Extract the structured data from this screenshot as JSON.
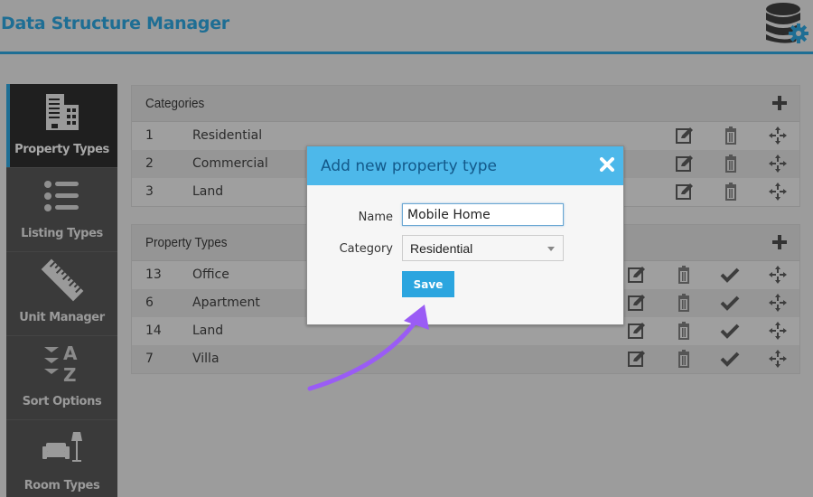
{
  "header": {
    "title": "Data Structure Manager",
    "icon": "database-gear-icon"
  },
  "sidebar": {
    "items": [
      {
        "label": "Property Types",
        "icon": "building-icon",
        "active": true
      },
      {
        "label": "Listing Types",
        "icon": "list-icon",
        "active": false
      },
      {
        "label": "Unit Manager",
        "icon": "ruler-icon",
        "active": false
      },
      {
        "label": "Sort Options",
        "icon": "sort-az-icon",
        "active": false
      },
      {
        "label": "Room Types",
        "icon": "sofa-lamp-icon",
        "active": false
      }
    ]
  },
  "categories": {
    "title": "Categories",
    "add_icon": "plus-icon",
    "rows": [
      {
        "id": "1",
        "name": "Residential"
      },
      {
        "id": "2",
        "name": "Commercial"
      },
      {
        "id": "3",
        "name": "Land"
      }
    ],
    "row_actions": [
      "edit-icon",
      "trash-icon",
      "move-icon"
    ]
  },
  "property_types": {
    "title": "Property Types",
    "add_icon": "plus-icon",
    "rows": [
      {
        "id": "13",
        "name": "Office"
      },
      {
        "id": "6",
        "name": "Apartment"
      },
      {
        "id": "14",
        "name": "Land"
      },
      {
        "id": "7",
        "name": "Villa"
      }
    ],
    "row_actions": [
      "edit-icon",
      "trash-icon",
      "check-icon",
      "move-icon"
    ]
  },
  "modal": {
    "title": "Add new property type",
    "close_icon": "close-icon",
    "name_label": "Name",
    "name_value": "Mobile Home",
    "category_label": "Category",
    "category_value": "Residential",
    "save_label": "Save"
  },
  "annotation": {
    "arrow_color": "#9a5cf5"
  },
  "colors": {
    "accent": "#1e6e94",
    "modal_header": "#4db8ea",
    "save_button": "#2ba5df"
  }
}
